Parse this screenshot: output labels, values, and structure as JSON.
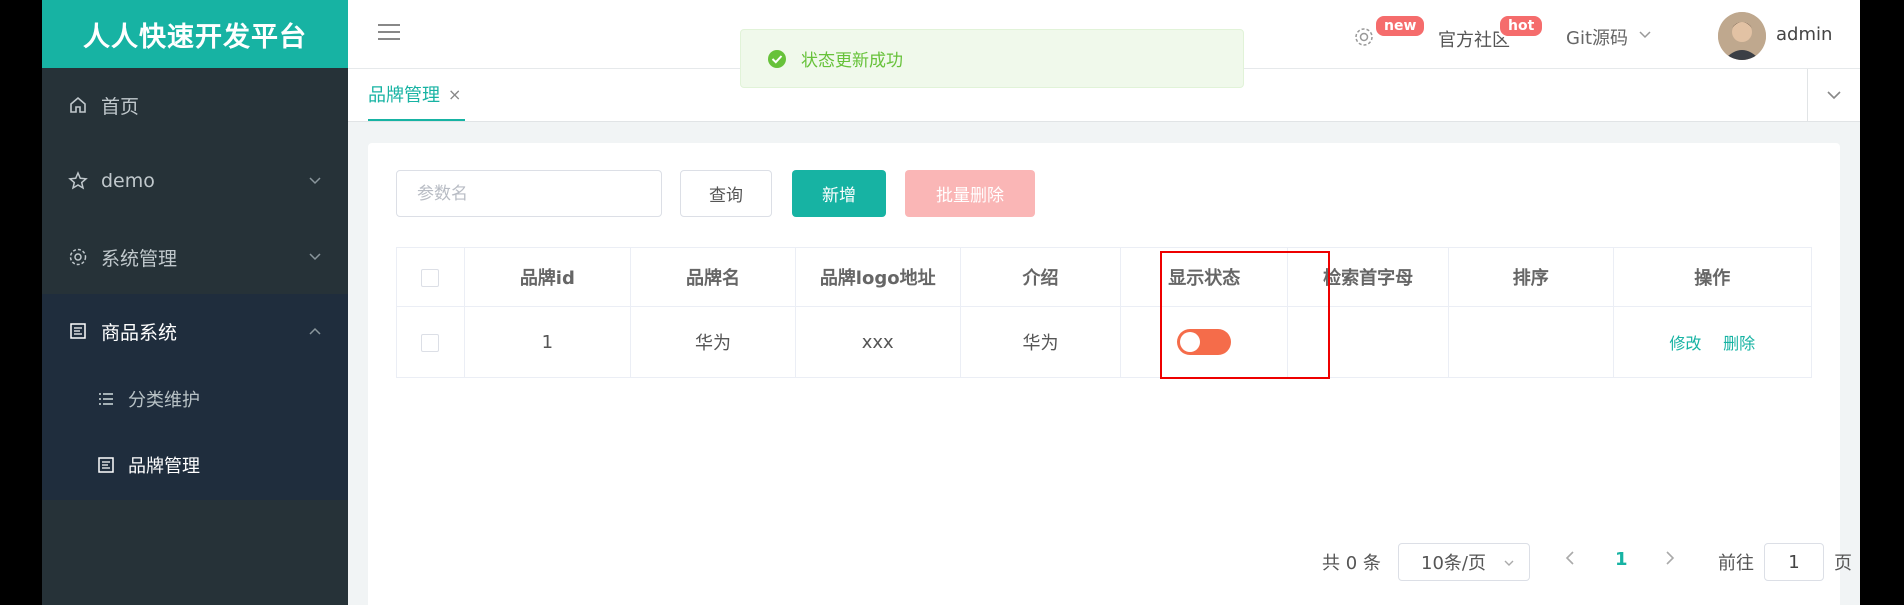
{
  "app": {
    "brand_title": "人人快速开发平台"
  },
  "sidebar": {
    "items": [
      {
        "label": "首页",
        "icon": "home-icon"
      },
      {
        "label": "demo",
        "icon": "star-icon"
      },
      {
        "label": "系统管理",
        "icon": "gear-icon"
      },
      {
        "label": "商品系统",
        "icon": "document-icon"
      }
    ],
    "subitems": [
      {
        "label": "分类维护",
        "icon": "list-icon"
      },
      {
        "label": "品牌管理",
        "icon": "document-icon"
      }
    ]
  },
  "header": {
    "badge_new": "new",
    "community": "官方社区",
    "badge_hot": "hot",
    "git": "Git源码",
    "username": "admin"
  },
  "toast": {
    "message": "状态更新成功"
  },
  "tabs": {
    "active_label": "品牌管理",
    "close": "×"
  },
  "toolbar": {
    "search_placeholder": "参数名",
    "query_label": "查询",
    "add_label": "新增",
    "batch_delete_label": "批量删除"
  },
  "table": {
    "columns": [
      "品牌id",
      "品牌名",
      "品牌logo地址",
      "介绍",
      "显示状态",
      "检索首字母",
      "排序",
      "操作"
    ],
    "rows": [
      {
        "id": "1",
        "name": "华为",
        "logo": "xxx",
        "intro": "华为",
        "show_status": false,
        "first_letter": "",
        "sort": "",
        "edit": "修改",
        "delete": "删除"
      }
    ]
  },
  "pagination": {
    "total": "共 0 条",
    "page_size": "10条/页",
    "current_page": "1",
    "goto_label": "前往",
    "goto_value": "1",
    "page_suffix": "页"
  },
  "colors": {
    "primary": "#17b3a3",
    "sidebar": "#263238",
    "danger": "#f56c6c",
    "success": "#67c23a"
  }
}
